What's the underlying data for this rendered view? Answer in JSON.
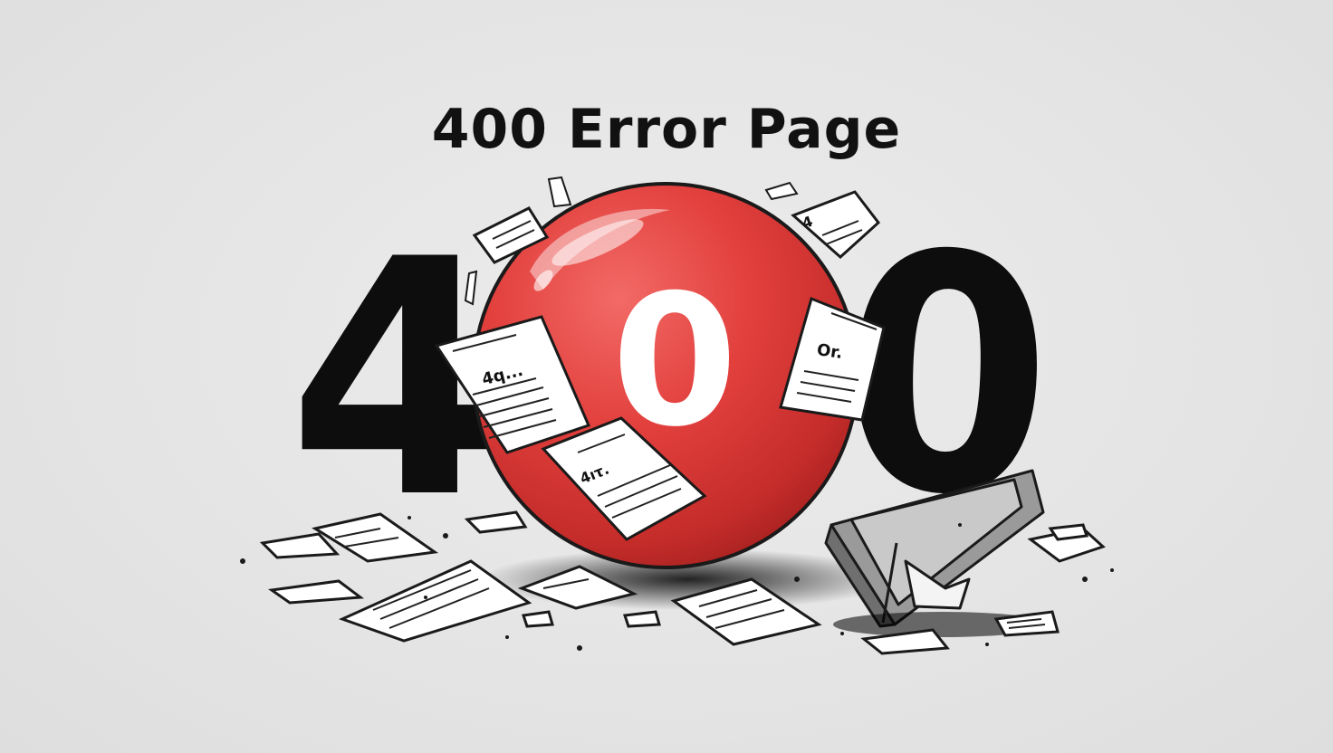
{
  "title": "400 Error Page",
  "big_number": {
    "left_digit": "4",
    "center_digit": "0",
    "right_digit": "0"
  },
  "paper_labels": [
    "4q...",
    "4ıτ.",
    "Or.",
    "4"
  ],
  "colors": {
    "background": "#e6e6e6",
    "ball": "#e2403d",
    "digits": "#0d0d0d",
    "paper": "#ffffff"
  }
}
